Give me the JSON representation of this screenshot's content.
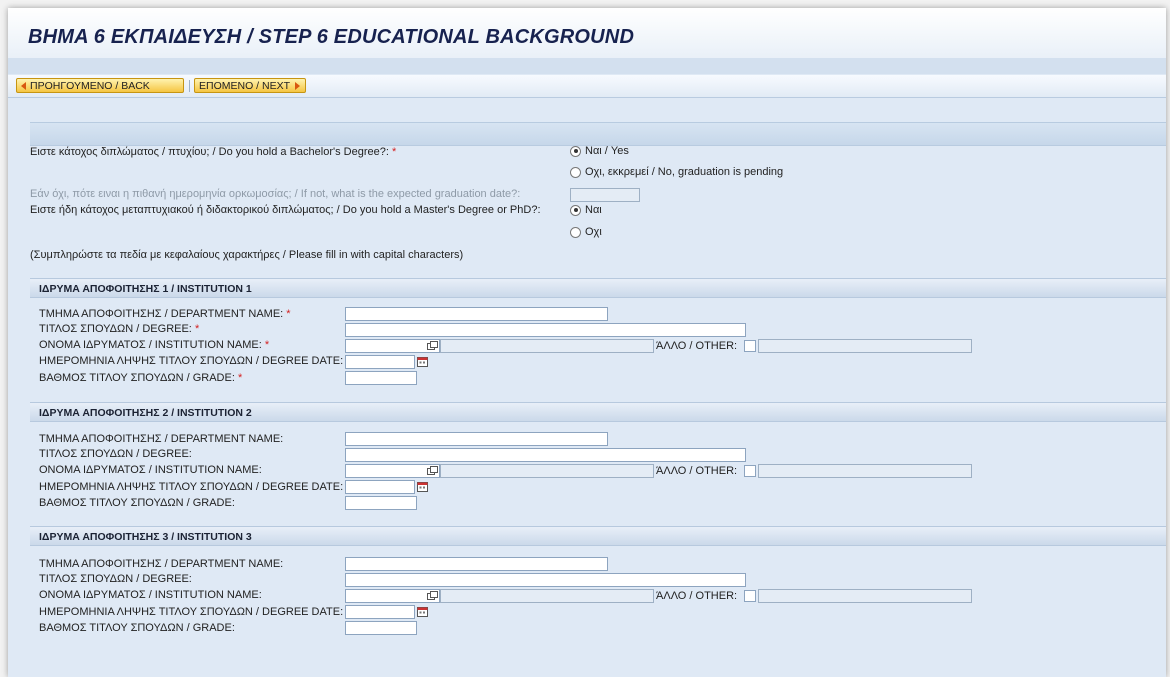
{
  "page": {
    "title": "ΒΗΜΑ 6 ΕΚΠΑΙΔΕΥΣΗ / STEP 6 EDUCATIONAL BACKGROUND"
  },
  "toolbar": {
    "back_label": "ΠΡΟΗΓΟΥΜΕΝΟ / BACK",
    "next_label": "ΕΠΟΜΕΝΟ / NEXT"
  },
  "questions": {
    "bachelor": {
      "label": "Ειστε κάτοχος διπλώματος / πτυχίου; / Do you hold a Bachelor's Degree?: ",
      "required_mark": "*",
      "options": [
        "Ναι / Yes",
        "Οχι, εκκρεμεί / No, graduation is pending"
      ],
      "selected": "Ναι / Yes"
    },
    "graduation_date": {
      "label": "Εάν όχι, πότε ειναι η πιθανή ημερομηνία ορκωμοσίας; / If not, what is the expected graduation date?:",
      "value": ""
    },
    "masters": {
      "label": "Ειστε ήδη κάτοχος μεταπτυχιακού ή διδακτορικού διπλώματος; / Do you hold a Master's Degree or PhD?:",
      "options": [
        "Ναι",
        "Οχι"
      ],
      "selected": "Ναι"
    },
    "capital_note": "(Συμπληρώστε τα πεδία με κεφαλαίους χαρακτήρες / Please fill in with capital characters)"
  },
  "field_labels": {
    "department": "ΤΜΗΜΑ ΑΠΟΦΟΙΤΗΣΗΣ / DEPARTMENT NAME:",
    "degree": "ΤΙΤΛΟΣ ΣΠΟΥΔΩΝ / DEGREE:",
    "institution": "ΟΝΟΜΑ ΙΔΡΥΜΑΤΟΣ / INSTITUTION NAME:",
    "degree_date": "ΗΜΕΡΟΜΗΝΙΑ ΛΗΨΗΣ ΤΙΤΛΟΥ ΣΠΟΥΔΩΝ / DEGREE DATE:",
    "grade": "ΒΑΘΜΟΣ ΤΙΤΛΟΥ ΣΠΟΥΔΩΝ / GRADE:",
    "other": "ΆΛΛΟ / OTHER:",
    "required_mark": "*"
  },
  "institutions": [
    {
      "title": "ΙΔΡΥΜΑ ΑΠΟΦΟΙΤΗΣΗΣ 1 / INSTITUTION 1",
      "department": "",
      "degree": "",
      "institution": "",
      "degree_date": "",
      "grade": "",
      "other_checked": false,
      "other_text": ""
    },
    {
      "title": "ΙΔΡΥΜΑ ΑΠΟΦΟΙΤΗΣΗΣ 2 / INSTITUTION 2",
      "department": "",
      "degree": "",
      "institution": "",
      "degree_date": "",
      "grade": "",
      "other_checked": false,
      "other_text": ""
    },
    {
      "title": "ΙΔΡΥΜΑ ΑΠΟΦΟΙΤΗΣΗΣ 3 / INSTITUTION 3",
      "department": "",
      "degree": "",
      "institution": "",
      "degree_date": "",
      "grade": "",
      "other_checked": false,
      "other_text": ""
    }
  ],
  "icons": {
    "back": "arrow-left-icon",
    "next": "arrow-right-icon",
    "dropdown": "value-help-icon",
    "calendar": "calendar-icon"
  },
  "colors": {
    "title": "#17224f",
    "required": "#d41f1f",
    "button": "#f5c542",
    "background": "#dfe9f5"
  }
}
